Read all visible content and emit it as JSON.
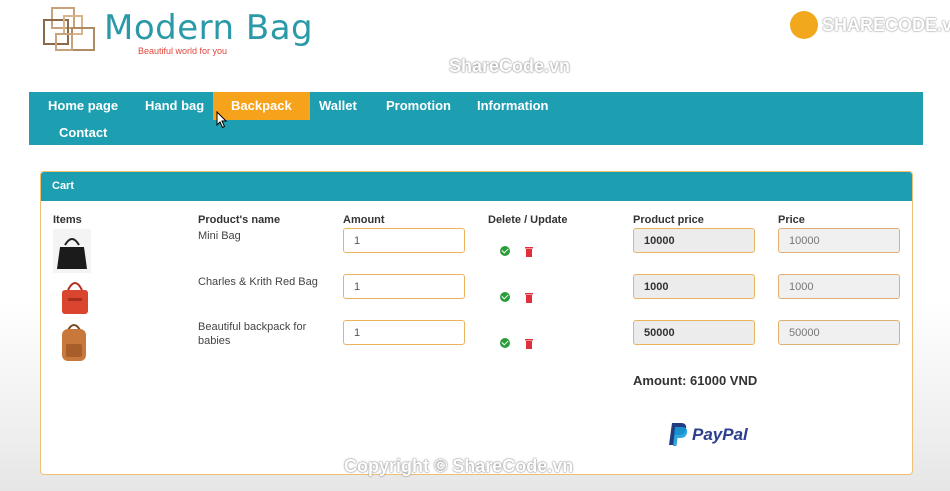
{
  "header": {
    "logo_title": "Modern Bag",
    "logo_slogan": "Beautiful world for you",
    "watermark_brand": "SHARECODE.vn",
    "watermark_top": "ShareCode.vn",
    "watermark_bottom": "Copyright © ShareCode.vn"
  },
  "nav": {
    "items": [
      {
        "label": "Home page"
      },
      {
        "label": "Hand bag"
      },
      {
        "label": "Backpack",
        "active": true
      },
      {
        "label": "Wallet"
      },
      {
        "label": "Promotion"
      },
      {
        "label": "Information"
      },
      {
        "label": "Contact"
      }
    ]
  },
  "cart": {
    "title": "Cart",
    "columns": {
      "items": "Items",
      "name": "Product's name",
      "amount": "Amount",
      "actions": "Delete / Update",
      "product_price": "Product price",
      "price": "Price"
    },
    "rows": [
      {
        "name": "Mini Bag",
        "amount": "1",
        "product_price": "10000",
        "price": "10000",
        "image": "black-handbag"
      },
      {
        "name": "Charles & Krith Red Bag",
        "amount": "1",
        "product_price": "1000",
        "price": "1000",
        "image": "red-bag"
      },
      {
        "name": "Beautiful backpack for babies",
        "amount": "1",
        "product_price": "50000",
        "price": "50000",
        "image": "brown-backpack"
      }
    ],
    "total": "Amount: 61000 VND",
    "paypal_label": "PayPal"
  },
  "colors": {
    "nav_bg": "#1d9fb1",
    "nav_active": "#f7a21b",
    "logo_text": "#2a9aa8",
    "field_border": "#e8b460"
  }
}
